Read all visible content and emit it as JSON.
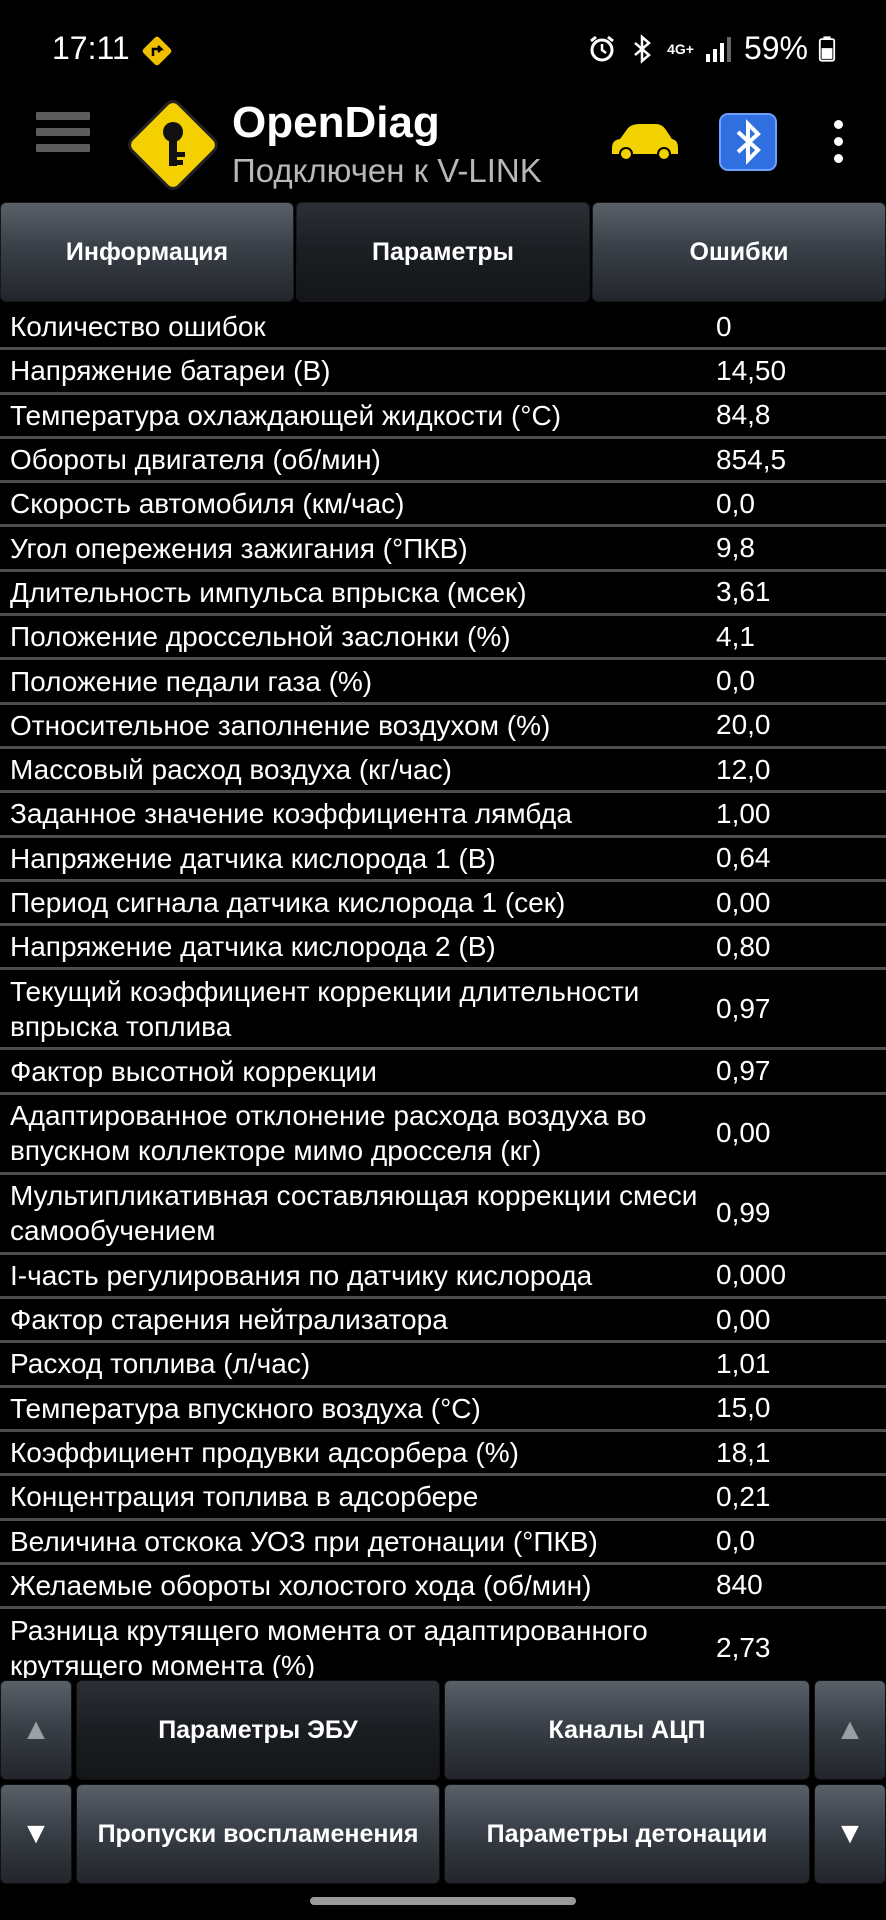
{
  "status_bar": {
    "time": "17:11",
    "network": "4G+",
    "battery": "59%",
    "icons": [
      "navigation-icon",
      "alarm-icon",
      "bluetooth-icon",
      "signal-icon",
      "battery-icon"
    ]
  },
  "app_bar": {
    "title": "OpenDiag",
    "subtitle": "Подключен к V-LINK",
    "icons": [
      "menu-icon",
      "app-logo-key",
      "car-icon",
      "bluetooth-icon",
      "more-icon"
    ],
    "colors": {
      "logo": "#f5d000",
      "car": "#f2d200",
      "bt_badge": "#2f6fe0"
    }
  },
  "tabs": [
    {
      "label": "Информация",
      "active": false
    },
    {
      "label": "Параметры",
      "active": true
    },
    {
      "label": "Ошибки",
      "active": false
    }
  ],
  "params": [
    {
      "name": "Количество ошибок",
      "value": "0"
    },
    {
      "name": "Напряжение батареи (В)",
      "value": "14,50"
    },
    {
      "name": "Температура охлаждающей жидкости (°С)",
      "value": "84,8"
    },
    {
      "name": "Обороты двигателя (об/мин)",
      "value": "854,5"
    },
    {
      "name": "Скорость автомобиля (км/час)",
      "value": "0,0"
    },
    {
      "name": "Угол опережения зажигания (°ПКВ)",
      "value": "9,8"
    },
    {
      "name": "Длительность импульса впрыска (мсек)",
      "value": "3,61"
    },
    {
      "name": "Положение дроссельной заслонки (%)",
      "value": "4,1"
    },
    {
      "name": "Положение педали газа (%)",
      "value": "0,0"
    },
    {
      "name": "Относительное заполнение воздухом (%)",
      "value": "20,0"
    },
    {
      "name": "Массовый расход воздуха (кг/час)",
      "value": "12,0"
    },
    {
      "name": "Заданное значение коэффициента лямбда",
      "value": "1,00"
    },
    {
      "name": "Напряжение датчика кислорода 1 (В)",
      "value": "0,64"
    },
    {
      "name": "Период сигнала датчика кислорода 1 (сек)",
      "value": "0,00"
    },
    {
      "name": "Напряжение датчика кислорода 2 (В)",
      "value": "0,80"
    },
    {
      "name": "Текущий коэффициент коррекции длительности впрыска топлива",
      "value": "0,97"
    },
    {
      "name": "Фактор высотной коррекции",
      "value": "0,97"
    },
    {
      "name": "Адаптированное отклонение расхода воздуха во впускном коллекторе мимо дросселя (кг)",
      "value": "0,00"
    },
    {
      "name": "Мультипликативная составляющая коррекции смеси самообучением",
      "value": "0,99"
    },
    {
      "name": "I-часть регулирования по датчику кислорода",
      "value": "0,000"
    },
    {
      "name": "Фактор старения нейтрализатора",
      "value": "0,00"
    },
    {
      "name": "Расход топлива (л/час)",
      "value": "1,01"
    },
    {
      "name": "Температура впускного воздуха (°С)",
      "value": "15,0"
    },
    {
      "name": "Коэффициент продувки адсорбера (%)",
      "value": "18,1"
    },
    {
      "name": "Концентрация топлива в адсорбере",
      "value": "0,21"
    },
    {
      "name": "Величина отскока УОЗ при детонации (°ПКВ)",
      "value": "0,0"
    },
    {
      "name": "Желаемые обороты холостого хода (об/мин)",
      "value": "840"
    },
    {
      "name": "Разница крутящего момента от адаптированного крутящего момента (%)",
      "value": "2,73"
    }
  ],
  "bottom": {
    "up_left": "▲",
    "down_left": "▼",
    "up_right": "▲",
    "down_right": "▼",
    "ecu_params": "Параметры ЭБУ",
    "adc_channels": "Каналы АЦП",
    "misfires": "Пропуски воспламенения",
    "detonation": "Параметры детонации"
  }
}
